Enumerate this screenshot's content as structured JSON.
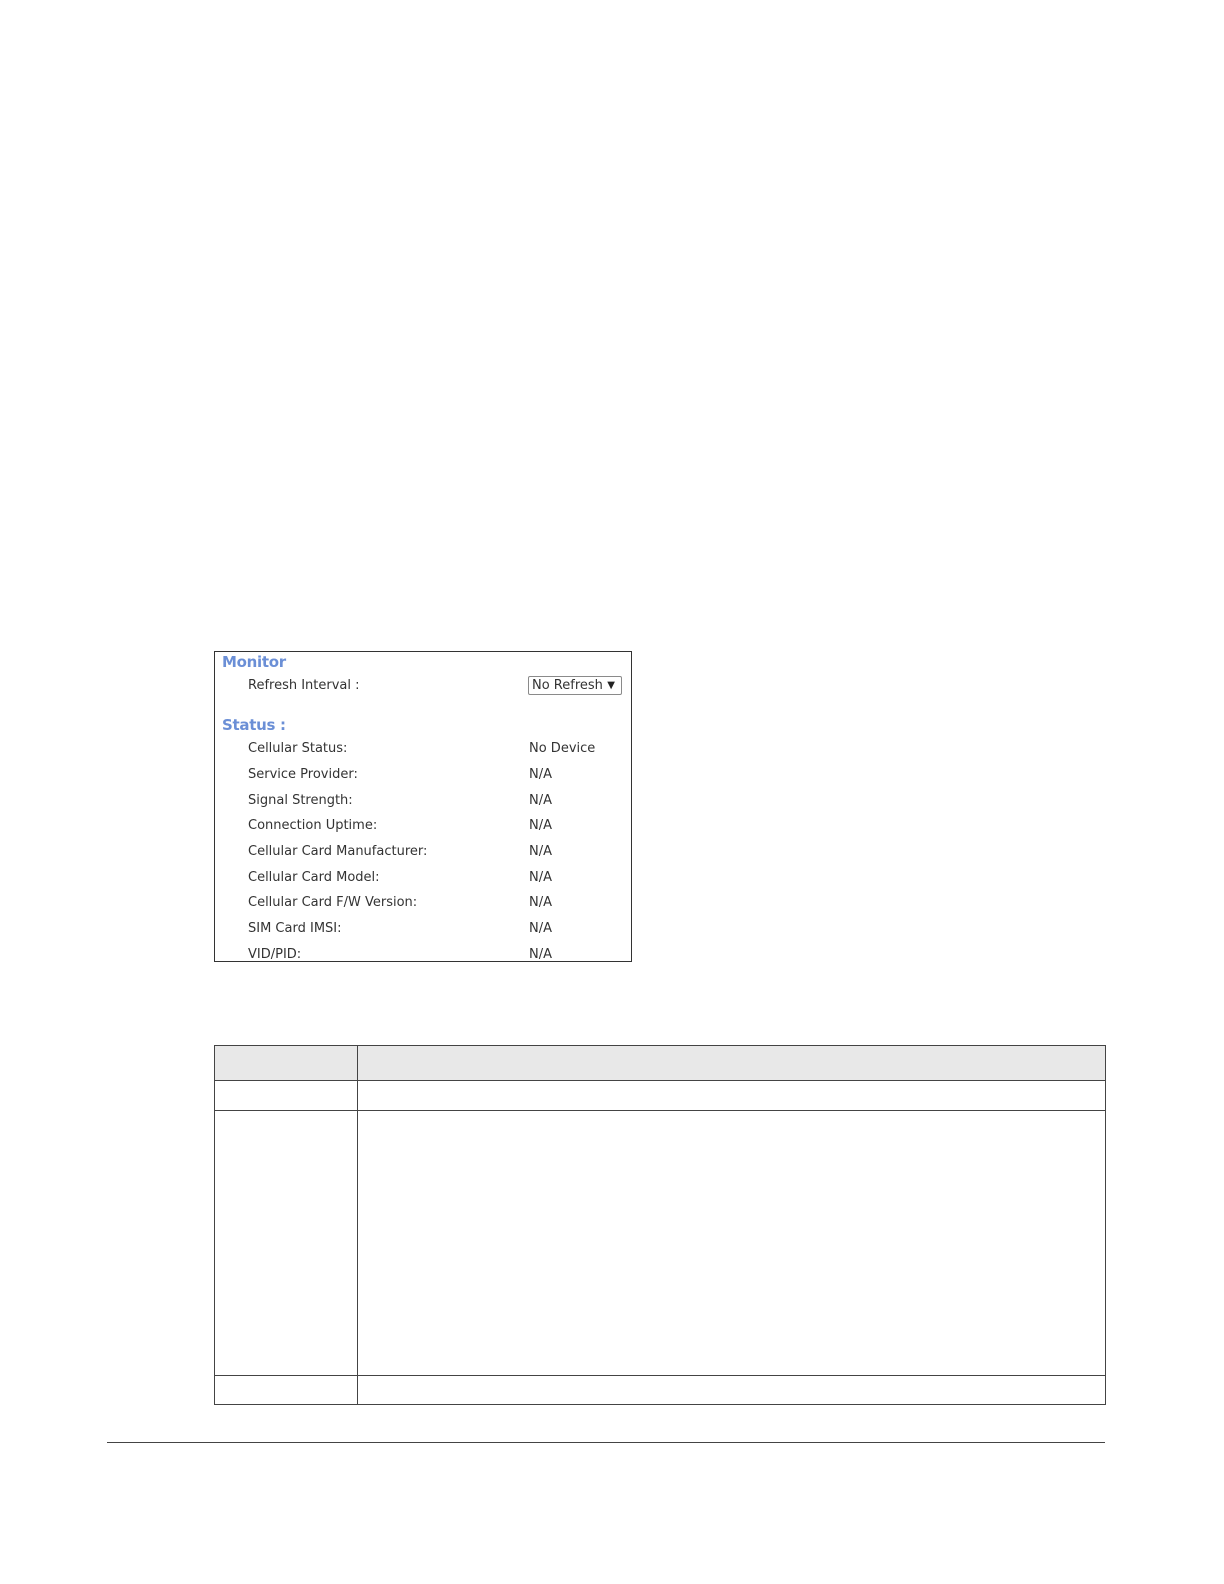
{
  "monitor": {
    "title": "Monitor",
    "refresh_label": "Refresh Interval :",
    "refresh_value": "No Refresh",
    "refresh_arrow": "▼"
  },
  "status": {
    "title": "Status :",
    "rows": [
      {
        "label": "Cellular Status:",
        "value": "No Device"
      },
      {
        "label": "Service Provider:",
        "value": "N/A"
      },
      {
        "label": "Signal Strength:",
        "value": "N/A"
      },
      {
        "label": "Connection Uptime:",
        "value": "N/A"
      },
      {
        "label": "Cellular Card Manufacturer:",
        "value": "N/A"
      },
      {
        "label": "Cellular Card Model:",
        "value": "N/A"
      },
      {
        "label": "Cellular Card F/W Version:",
        "value": "N/A"
      },
      {
        "label": "SIM Card IMSI:",
        "value": "N/A"
      },
      {
        "label": "VID/PID:",
        "value": "N/A"
      }
    ]
  },
  "colors": {
    "section_title": "#6b8fd6",
    "table_header_bg": "#e8e8e8"
  }
}
